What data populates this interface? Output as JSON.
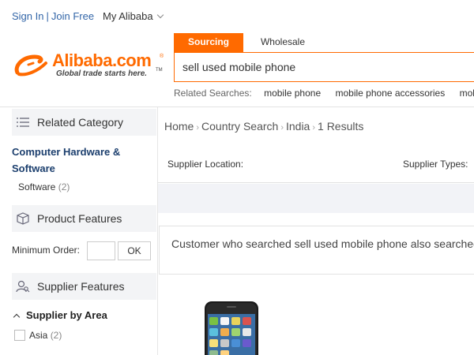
{
  "topbar": {
    "sign_in": "Sign In",
    "join_free": "Join Free",
    "my_alibaba": "My Alibaba"
  },
  "logo": {
    "name": "Alibaba.com",
    "tagline": "Global trade starts here.",
    "brand_color": "#ff6a00"
  },
  "search": {
    "tabs": [
      {
        "label": "Sourcing",
        "active": true
      },
      {
        "label": "Wholesale",
        "active": false
      }
    ],
    "query": "sell used mobile phone",
    "related_label": "Related Searches:",
    "related": [
      "mobile phone",
      "mobile phone accessories",
      "mobi"
    ]
  },
  "sidebar": {
    "related_category": {
      "label": "Related Category",
      "icon": "list-icon",
      "title": "Computer Hardware & Software",
      "items": [
        {
          "label": "Software",
          "count": "(2)"
        }
      ]
    },
    "product_features": {
      "label": "Product Features",
      "icon": "box-icon",
      "min_order_label": "Minimum Order:",
      "ok_label": "OK"
    },
    "supplier_features": {
      "label": "Supplier Features",
      "icon": "user-search-icon",
      "area_label": "Supplier by Area",
      "areas": [
        {
          "label": "Asia",
          "count": "(2)"
        }
      ]
    }
  },
  "main": {
    "breadcrumb": [
      "Home",
      "Country Search",
      "India",
      "1 Results"
    ],
    "filters": {
      "location": "Supplier Location:",
      "types": "Supplier Types:"
    },
    "customer_text": "Customer who searched sell used mobile phone also searched"
  }
}
